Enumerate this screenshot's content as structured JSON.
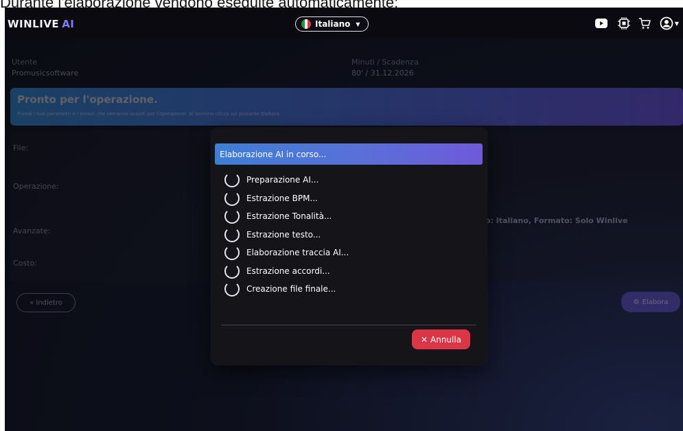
{
  "caption": "Durante l'elaborazione vengono eseguite automaticamente:",
  "topbar": {
    "logo_main": "WINLIVE",
    "logo_ai": "AI",
    "language": "Italiano",
    "icons": [
      "youtube-icon",
      "chip-icon",
      "cart-icon",
      "user-icon"
    ]
  },
  "info": {
    "user_label": "Utente",
    "user_value": "Promusicsoftware",
    "minutes_label": "Minuti / Scadenza",
    "minutes_value": "80' / 31.12.2026"
  },
  "banner": {
    "title": "Pronto per l'operazione.",
    "text": "Rivedi i tuoi parametri e i minuti che verranno scalati per l'operazione. Al termine clicca sul pulsante Elabora"
  },
  "panel": {
    "file_label": "File:",
    "operation_label": "Operazione:",
    "advanced_label": "Avanzate:",
    "advanced_value": "o: Italiano, Formato: Solo Winlive",
    "cost_label": "Costo:"
  },
  "buttons": {
    "back": "« Indietro",
    "process": "Elabora"
  },
  "modal": {
    "title": "Elaborazione AI in corso...",
    "steps": [
      "Preparazione AI...",
      "Estrazione BPM...",
      "Estrazione Tonalità...",
      "Estrazione testo...",
      "Elaborazione traccia AI...",
      "Estrazione accordi...",
      "Creazione file finale..."
    ],
    "cancel": "Annulla"
  },
  "colors": {
    "accent": "#6f5ad8",
    "danger": "#dc3545",
    "header_start": "#3d7fd6"
  }
}
